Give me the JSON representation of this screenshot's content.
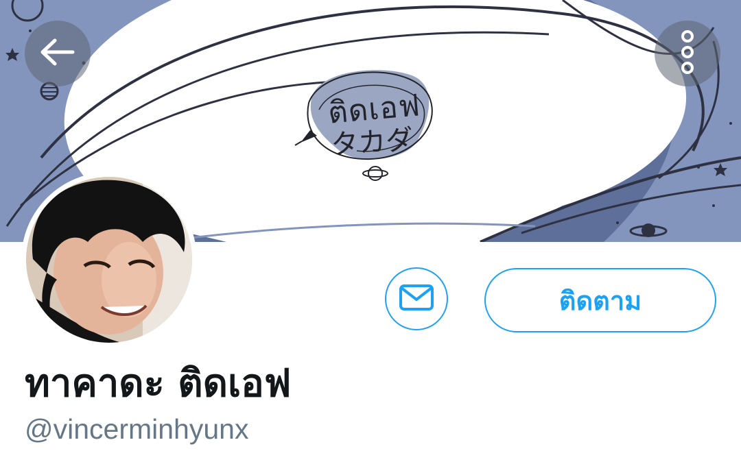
{
  "banner": {
    "title": "ติดเอฟ",
    "subtitle": "タカダ"
  },
  "profile": {
    "display_name": "ทาคาดะ ติดเอฟ",
    "handle": "@vincerminhyunx"
  },
  "actions": {
    "follow_label": "ติดตาม"
  },
  "icons": {
    "back": "back-arrow-icon",
    "more": "more-vertical-icon",
    "message": "envelope-icon"
  },
  "colors": {
    "accent": "#1da1f2",
    "name": "#14171a",
    "handle": "#657786",
    "banner_blue": "#5e6f99"
  }
}
